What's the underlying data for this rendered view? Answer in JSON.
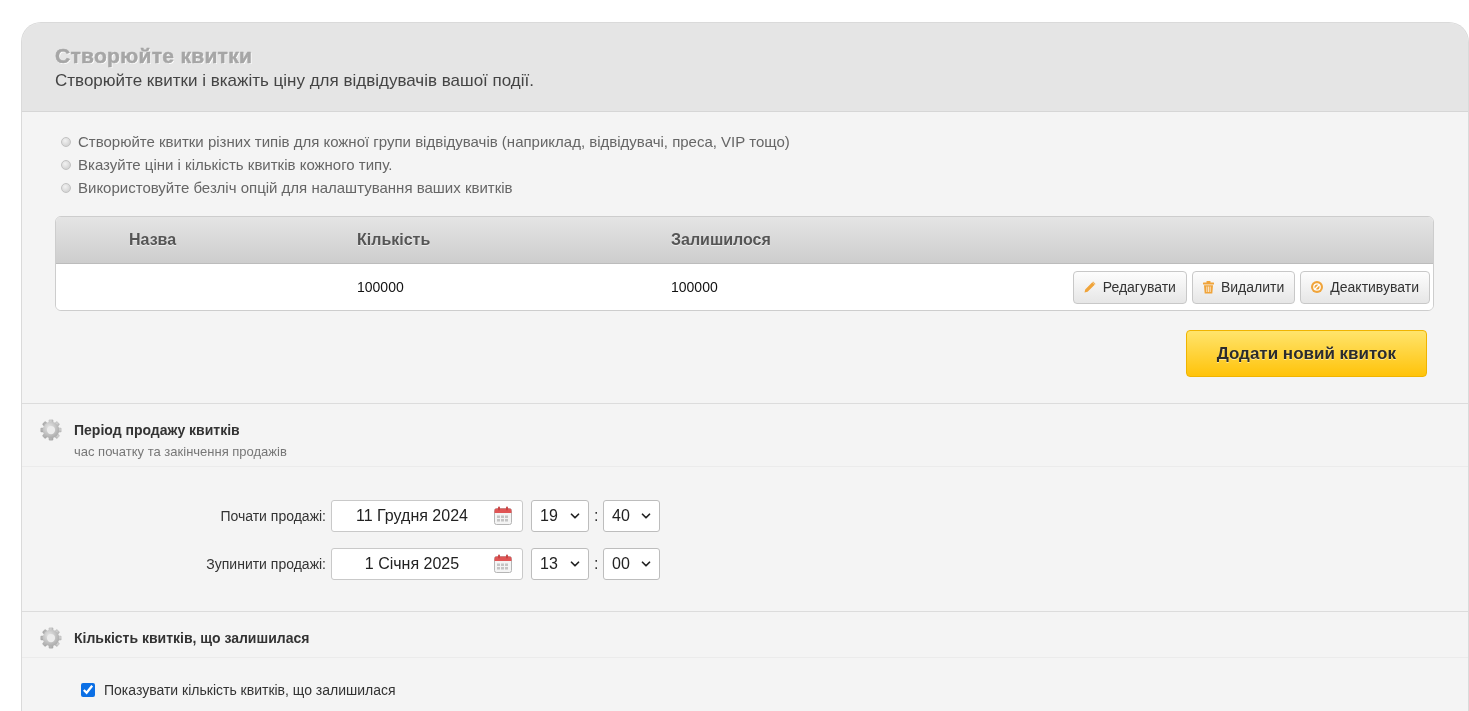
{
  "header": {
    "title": "Створюйте квитки",
    "subtitle": "Створюйте квитки і вкажіть ціну для відвідувачів вашої події."
  },
  "tips": [
    "Створюйте квитки різних типів для кожної групи відвідувачів (наприклад, відвідувачі, преса, VIP тощо)",
    "Вказуйте ціни і кількість квитків кожного типу.",
    "Використовуйте безліч опцій для налаштування ваших квитків"
  ],
  "tickets_table": {
    "columns": [
      "Назва",
      "Кількість",
      "Залишилося"
    ],
    "rows": [
      {
        "quantity": "100000",
        "remaining": "100000",
        "actions": [
          {
            "kind": "edit",
            "label": "Редагувати"
          },
          {
            "kind": "delete",
            "label": "Видалити"
          },
          {
            "kind": "deactivate",
            "label": "Деактивувати"
          }
        ]
      }
    ]
  },
  "add_button": {
    "label": "Додати новий квиток"
  },
  "sections": [
    {
      "kind": "sale_period",
      "title": "Період продажу квитків",
      "subtitle": "час початку та закінчення продажів",
      "rows": [
        {
          "label": "Почати продажі:",
          "date": "11 Грудня 2024",
          "hour": "19",
          "separator": ":",
          "minute": "40"
        },
        {
          "label": "Зупинити продажі:",
          "date": "1 Січня 2025",
          "hour": "13",
          "separator": ":",
          "minute": "00"
        }
      ]
    },
    {
      "kind": "remaining_count",
      "title": "Кількість квитків, що залишилася",
      "checkbox": {
        "label": "Показувати кількість квитків, що залишилася",
        "checked": true
      }
    }
  ]
}
